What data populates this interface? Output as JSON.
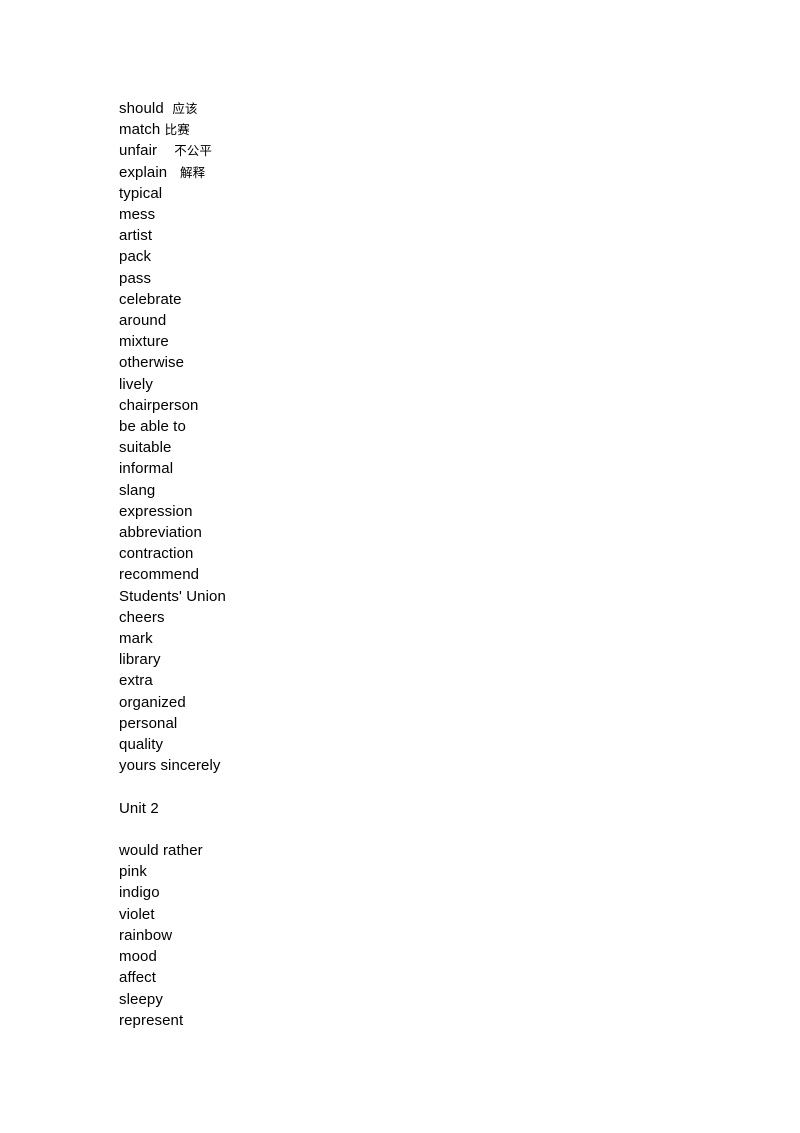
{
  "document": {
    "background_color": "#ffffff",
    "text_color": "#000000",
    "lines": [
      {
        "type": "entry",
        "en": "should",
        "gap": "  ",
        "zh": "应该"
      },
      {
        "type": "entry",
        "en": "match",
        "gap": " ",
        "zh": "比赛"
      },
      {
        "type": "entry",
        "en": "unfair",
        "gap": "    ",
        "zh": "不公平"
      },
      {
        "type": "entry",
        "en": "explain",
        "gap": "   ",
        "zh": "解释"
      },
      {
        "type": "entry",
        "en": "typical",
        "gap": "",
        "zh": ""
      },
      {
        "type": "entry",
        "en": "mess",
        "gap": "",
        "zh": ""
      },
      {
        "type": "entry",
        "en": "artist",
        "gap": "",
        "zh": ""
      },
      {
        "type": "entry",
        "en": "pack",
        "gap": "",
        "zh": ""
      },
      {
        "type": "entry",
        "en": "pass",
        "gap": "",
        "zh": ""
      },
      {
        "type": "entry",
        "en": "celebrate",
        "gap": "",
        "zh": ""
      },
      {
        "type": "entry",
        "en": "around",
        "gap": "",
        "zh": ""
      },
      {
        "type": "entry",
        "en": "mixture",
        "gap": "",
        "zh": ""
      },
      {
        "type": "entry",
        "en": "otherwise",
        "gap": "",
        "zh": ""
      },
      {
        "type": "entry",
        "en": "lively",
        "gap": "",
        "zh": ""
      },
      {
        "type": "entry",
        "en": "chairperson",
        "gap": "",
        "zh": ""
      },
      {
        "type": "entry",
        "en": "be able to",
        "gap": "",
        "zh": ""
      },
      {
        "type": "entry",
        "en": "suitable",
        "gap": "",
        "zh": ""
      },
      {
        "type": "entry",
        "en": "informal",
        "gap": "",
        "zh": ""
      },
      {
        "type": "entry",
        "en": "slang",
        "gap": "",
        "zh": ""
      },
      {
        "type": "entry",
        "en": "expression",
        "gap": "",
        "zh": ""
      },
      {
        "type": "entry",
        "en": "abbreviation",
        "gap": "",
        "zh": ""
      },
      {
        "type": "entry",
        "en": "contraction",
        "gap": "",
        "zh": ""
      },
      {
        "type": "entry",
        "en": "recommend",
        "gap": "",
        "zh": ""
      },
      {
        "type": "entry",
        "en": "Students' Union",
        "gap": "",
        "zh": ""
      },
      {
        "type": "entry",
        "en": "cheers",
        "gap": "",
        "zh": ""
      },
      {
        "type": "entry",
        "en": "mark",
        "gap": "",
        "zh": ""
      },
      {
        "type": "entry",
        "en": "library",
        "gap": "",
        "zh": ""
      },
      {
        "type": "entry",
        "en": "extra",
        "gap": "",
        "zh": ""
      },
      {
        "type": "entry",
        "en": "organized",
        "gap": "",
        "zh": ""
      },
      {
        "type": "entry",
        "en": "personal",
        "gap": "",
        "zh": ""
      },
      {
        "type": "entry",
        "en": "quality",
        "gap": "",
        "zh": ""
      },
      {
        "type": "entry",
        "en": "yours sincerely",
        "gap": "",
        "zh": ""
      },
      {
        "type": "blank",
        "en": "",
        "gap": "",
        "zh": ""
      },
      {
        "type": "heading",
        "en": "Unit 2",
        "gap": "",
        "zh": ""
      },
      {
        "type": "blank",
        "en": "",
        "gap": "",
        "zh": ""
      },
      {
        "type": "entry",
        "en": "would rather",
        "gap": "",
        "zh": ""
      },
      {
        "type": "entry",
        "en": "pink",
        "gap": "",
        "zh": ""
      },
      {
        "type": "entry",
        "en": "indigo",
        "gap": "",
        "zh": ""
      },
      {
        "type": "entry",
        "en": "violet",
        "gap": "",
        "zh": ""
      },
      {
        "type": "entry",
        "en": "rainbow",
        "gap": "",
        "zh": ""
      },
      {
        "type": "entry",
        "en": "mood",
        "gap": "",
        "zh": ""
      },
      {
        "type": "entry",
        "en": "affect",
        "gap": "",
        "zh": ""
      },
      {
        "type": "entry",
        "en": "sleepy",
        "gap": "",
        "zh": ""
      },
      {
        "type": "entry",
        "en": "represent",
        "gap": "",
        "zh": ""
      }
    ]
  }
}
